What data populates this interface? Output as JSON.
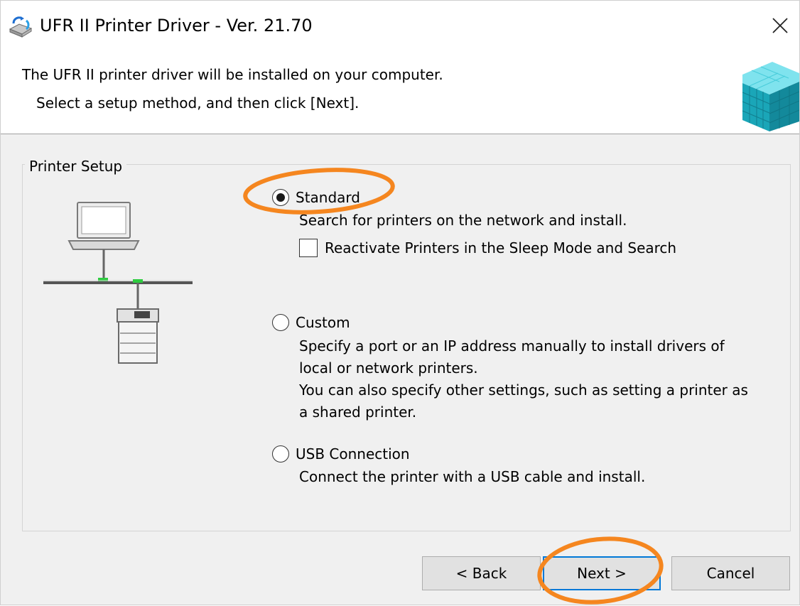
{
  "window": {
    "title": "UFR II Printer Driver - Ver. 21.70"
  },
  "header": {
    "line1": "The UFR II printer driver will be installed on your computer.",
    "line2": "Select a setup method, and then click [Next]."
  },
  "printer_setup": {
    "legend": "Printer Setup",
    "options": [
      {
        "label": "Standard",
        "selected": true,
        "description": [
          "Search for printers on the network and install."
        ]
      },
      {
        "label": "Custom",
        "selected": false,
        "description": [
          "Specify a port or an IP address manually to install drivers of",
          "local or network printers.",
          "You can also specify other settings, such as setting a printer as",
          "a shared printer."
        ]
      },
      {
        "label": "USB Connection",
        "selected": false,
        "description": [
          "Connect the printer with a USB cable and install."
        ]
      }
    ],
    "reactivate_checkbox": {
      "label": "Reactivate Printers in the Sleep Mode and Search",
      "checked": false
    }
  },
  "buttons": {
    "back": "< Back",
    "next": "Next >",
    "cancel": "Cancel"
  },
  "icons": {
    "app": "printer-driver-app-icon",
    "close": "close-icon",
    "header": "cube-logo-icon",
    "illustration": "network-printer-illustration"
  },
  "colors": {
    "accent": "#0078d7",
    "annotation": "#f5861f",
    "cube": "#1fb8c6"
  }
}
